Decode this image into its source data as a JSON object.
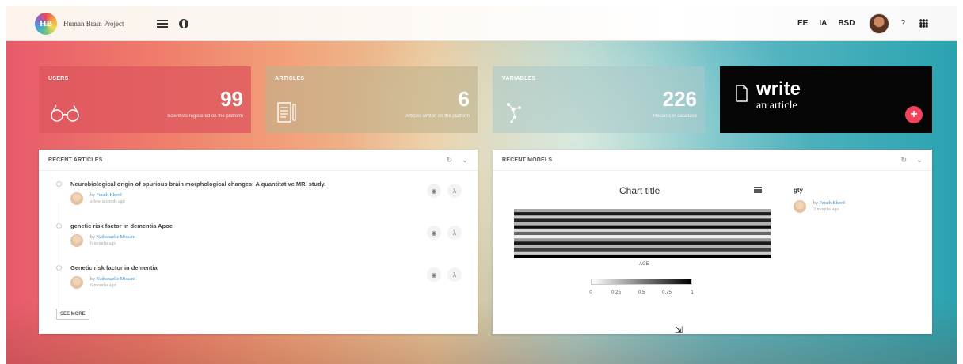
{
  "header": {
    "brand_initials": "HB",
    "brand_name": "Human Brain Project",
    "links": [
      "EE",
      "IA",
      "BSD"
    ],
    "help": "?"
  },
  "stats": {
    "users": {
      "label": "USERS",
      "value": "99",
      "desc": "Scientists registered on the platform"
    },
    "articles": {
      "label": "ARTICLES",
      "value": "6",
      "desc": "Articles written on the platform"
    },
    "variables": {
      "label": "VARIABLES",
      "value": "226",
      "desc": "Records in database"
    },
    "write": {
      "title": "write",
      "subtitle": "an article",
      "plus": "+"
    }
  },
  "recent_articles": {
    "title": "RECENT ARTICLES",
    "items": [
      {
        "title": "Neurobiological origin of spurious brain morphological changes: A quantitative MRI study.",
        "by": "by",
        "author": "Ferath Kherif",
        "time": "a few seconds ago"
      },
      {
        "title": "genetic risk factor in dementia Apoe",
        "by": "by",
        "author": "Nathanaelle Missard",
        "time": "6 months ago"
      },
      {
        "title": "Genetic risk factor in dementia",
        "by": "by",
        "author": "Nathanaelle Missard",
        "time": "6 months ago"
      }
    ],
    "see_more": "SEE MORE"
  },
  "recent_models": {
    "title": "RECENT MODELS",
    "chart_title": "Chart title",
    "model_name": "gty",
    "by": "by",
    "author": "Ferath Kherif",
    "time": "3 months ago"
  },
  "chart_data": {
    "type": "heatmap",
    "title": "Chart title",
    "xlabel": "AGE",
    "colorscale_ticks": [
      "0",
      "0.25",
      "0.5",
      "0.75",
      "1"
    ],
    "values": [
      0.35,
      0.9,
      0.2,
      0.85,
      0.3,
      0.95,
      0.15,
      0.6,
      0.05,
      0.4,
      0.9,
      0.3,
      0.75,
      0.2,
      1.0
    ]
  }
}
